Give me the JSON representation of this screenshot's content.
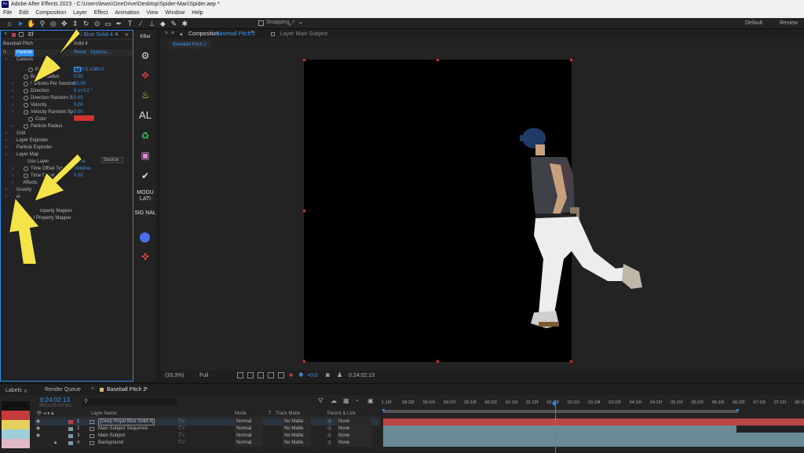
{
  "window": {
    "title": "Adobe After Effects 2023 - C:\\Users\\lewis\\OneDrive\\Desktop\\Spider-Man\\Spider.aep *",
    "logo": "Ae"
  },
  "menu": [
    "File",
    "Edit",
    "Composition",
    "Layer",
    "Effect",
    "Animation",
    "View",
    "Window",
    "Help"
  ],
  "toolbar": {
    "snapping_label": "Snapping",
    "workspaces": [
      "Default",
      "Review"
    ]
  },
  "effect_controls": {
    "tab_label": "Ef",
    "tab_layer": "al Blue Solid 4",
    "header_left": "Baseball Pitch",
    "header_right": "ue Solid 4",
    "fx_label": "Particle",
    "reset": "Reset",
    "options": "Options...",
    "rows": [
      {
        "label": "Cannon",
        "value": ""
      },
      {
        "label": "Position",
        "value": "1920.0,1080.0"
      },
      {
        "label": "Barrel Radius",
        "value": "0.00"
      },
      {
        "label": "Particles Per Second",
        "value": "60.00"
      },
      {
        "label": "Direction",
        "value": "0 x+0.0 °"
      },
      {
        "label": "Direction Random S",
        "value": "0.00"
      },
      {
        "label": "Velocity",
        "value": "0.00"
      },
      {
        "label": "Velocity Random Sp",
        "value": "0.00"
      },
      {
        "label": "Color",
        "value": ""
      },
      {
        "label": "Particle Radius",
        "value": ""
      },
      {
        "label": "Grid",
        "value": ""
      },
      {
        "label": "Layer Exploder",
        "value": ""
      },
      {
        "label": "Particle Exploder",
        "value": ""
      },
      {
        "label": "Layer Map",
        "value": ""
      },
      {
        "label": "Use Layer",
        "value": "None"
      },
      {
        "label": "Time Offset Type",
        "value": "Relative"
      },
      {
        "label": "Time Offset",
        "value": "0.00"
      },
      {
        "label": "Affects",
        "value": ""
      },
      {
        "label": "Gravity",
        "value": ""
      },
      {
        "label": "el",
        "value": ""
      },
      {
        "label": "roperty Mapper",
        "value": ""
      },
      {
        "label": "l Property Mapper",
        "value": ""
      }
    ],
    "source_label": "Source"
  },
  "script_panel": {
    "label_top": "KBar",
    "al_label": "AL",
    "modu_label": "MODU LATI",
    "sig_label": "SIG NAL"
  },
  "composition": {
    "tab_label": "Composition",
    "comp_name": "Baseball Pitch 2",
    "layer_tab": "Layer Main Subject",
    "sub_tab": "Baseball Pitch 2",
    "zoom": "(33.3%)",
    "resolution": "Full",
    "exposure": "+0.0",
    "timecode": "0:24:02:13"
  },
  "timeline": {
    "tabs": [
      "Labels",
      "Render Queue",
      "Baseball Pitch 2"
    ],
    "current_time": "0:24:02:13",
    "fps_info": "34613 (23.976 fps)",
    "columns": {
      "layer_name": "Layer Name",
      "mode": "Mode",
      "t": "T",
      "track_matte": "Track Matte",
      "parent": "Parent & Link"
    },
    "layers": [
      {
        "num": "1",
        "name": "[Deep Royal Blue Solid 4]",
        "mode": "Normal",
        "matte": "No Matte",
        "parent": "None",
        "color": "#c43c3c"
      },
      {
        "num": "2",
        "name": "Main Subject Sequence",
        "mode": "Normal",
        "matte": "No Matte",
        "parent": "None",
        "color": "#7a9aa8"
      },
      {
        "num": "3",
        "name": "Main Subject",
        "mode": "Normal",
        "matte": "No Matte",
        "parent": "None",
        "color": "#7a9aa8"
      },
      {
        "num": "4",
        "name": "Background",
        "mode": "Normal",
        "matte": "No Matte",
        "parent": "None",
        "color": "#7a9aa8"
      }
    ],
    "ruler": [
      "1:10f",
      "58:22f",
      "59:10f",
      "59:22f",
      "00:10f",
      "00:22f",
      "01:10f",
      "01:22f",
      "02:10f",
      "02:22f",
      "03:10f",
      "03:22f",
      "04:10f",
      "04:22f",
      "05:10f",
      "05:22f",
      "06:10f",
      "06:22f",
      "07:10f",
      "07:22f",
      "08:10"
    ]
  },
  "colors": {
    "accent": "#2d8ceb",
    "label_red": "#c43c3c",
    "label_yellow": "#e4d05c",
    "arrow_yellow": "#f5e34a"
  }
}
